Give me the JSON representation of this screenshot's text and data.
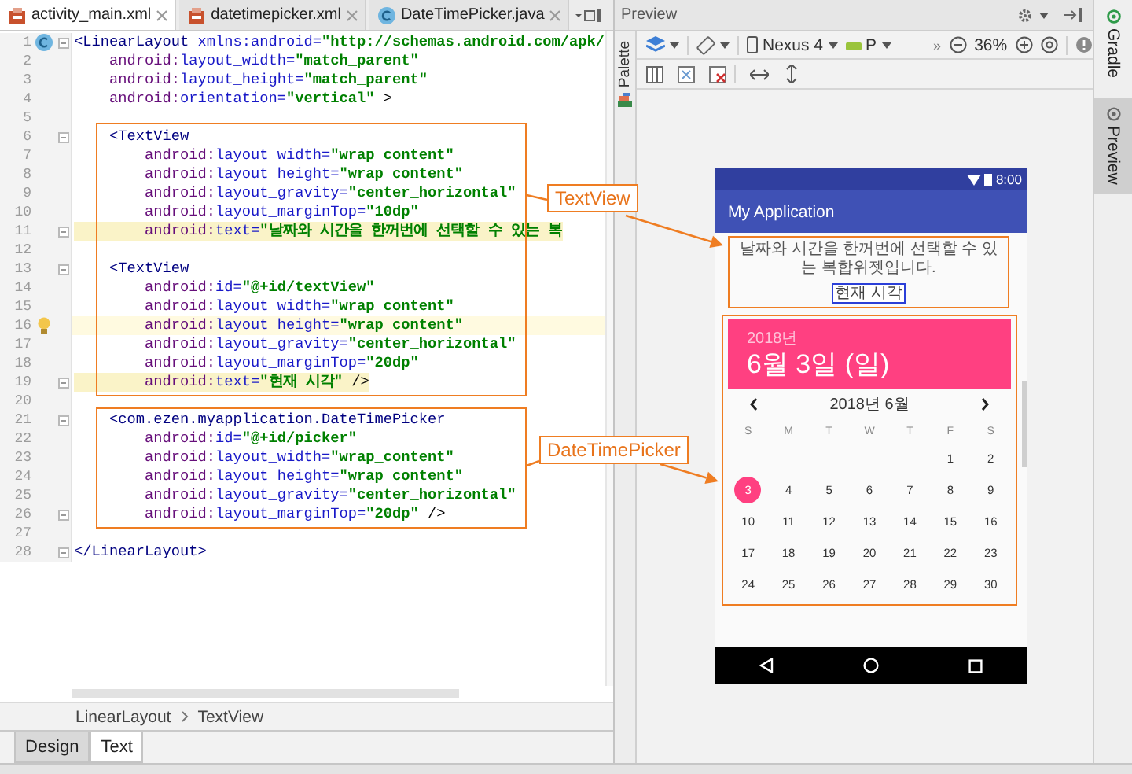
{
  "editor_tabs": [
    {
      "label": "activity_main.xml",
      "selected": true
    },
    {
      "label": "datetimepicker.xml",
      "selected": false
    },
    {
      "label": "DateTimePicker.java",
      "selected": false
    }
  ],
  "code_lines": [
    {
      "number": "1",
      "fold": true,
      "current": false,
      "highlighted": false,
      "segments": [
        {
          "kind": "tag",
          "text": "<LinearLayout"
        },
        {
          "kind": "attr",
          "text": " xmlns:android="
        },
        {
          "kind": "value",
          "text": "\"http://schemas.android.com/apk/"
        }
      ]
    },
    {
      "number": "2",
      "fold": false,
      "current": false,
      "highlighted": false,
      "segments": [
        {
          "kind": "ns",
          "text": "    android:"
        },
        {
          "kind": "attr",
          "text": "layout_width="
        },
        {
          "kind": "value",
          "text": "\"match_parent\""
        }
      ]
    },
    {
      "number": "3",
      "fold": false,
      "current": false,
      "highlighted": false,
      "segments": [
        {
          "kind": "ns",
          "text": "    android:"
        },
        {
          "kind": "attr",
          "text": "layout_height="
        },
        {
          "kind": "value",
          "text": "\"match_parent\""
        }
      ]
    },
    {
      "number": "4",
      "fold": false,
      "current": false,
      "highlighted": false,
      "segments": [
        {
          "kind": "ns",
          "text": "    android:"
        },
        {
          "kind": "attr",
          "text": "orientation="
        },
        {
          "kind": "value",
          "text": "\"vertical\""
        },
        {
          "kind": "plain",
          "text": " >"
        }
      ]
    },
    {
      "number": "5",
      "fold": false,
      "current": false,
      "highlighted": false
    },
    {
      "number": "6",
      "fold": true,
      "current": false,
      "highlighted": false,
      "segments": [
        {
          "kind": "tag",
          "text": "    <TextView"
        }
      ]
    },
    {
      "number": "7",
      "fold": false,
      "current": false,
      "highlighted": false,
      "segments": [
        {
          "kind": "ns",
          "text": "        android:"
        },
        {
          "kind": "attr",
          "text": "layout_width="
        },
        {
          "kind": "value",
          "text": "\"wrap_content\""
        }
      ]
    },
    {
      "number": "8",
      "fold": false,
      "current": false,
      "highlighted": false,
      "segments": [
        {
          "kind": "ns",
          "text": "        android:"
        },
        {
          "kind": "attr",
          "text": "layout_height="
        },
        {
          "kind": "value",
          "text": "\"wrap_content\""
        }
      ]
    },
    {
      "number": "9",
      "fold": false,
      "current": false,
      "highlighted": false,
      "segments": [
        {
          "kind": "ns",
          "text": "        android:"
        },
        {
          "kind": "attr",
          "text": "layout_gravity="
        },
        {
          "kind": "value",
          "text": "\"center_horizontal\""
        }
      ]
    },
    {
      "number": "10",
      "fold": false,
      "current": false,
      "highlighted": false,
      "segments": [
        {
          "kind": "ns",
          "text": "        android:"
        },
        {
          "kind": "attr",
          "text": "layout_marginTop="
        },
        {
          "kind": "value",
          "text": "\"10dp\""
        }
      ]
    },
    {
      "number": "11",
      "fold": true,
      "current": false,
      "highlighted": true,
      "segments": [
        {
          "kind": "ns",
          "text": "        android:"
        },
        {
          "kind": "attr",
          "text": "text="
        },
        {
          "kind": "value",
          "text": "\"날짜와 시간을 한꺼번에 선택할 수 있는 복"
        }
      ]
    },
    {
      "number": "12",
      "fold": false,
      "current": false,
      "highlighted": false
    },
    {
      "number": "13",
      "fold": true,
      "current": false,
      "highlighted": false,
      "segments": [
        {
          "kind": "tag",
          "text": "    <TextView"
        }
      ]
    },
    {
      "number": "14",
      "fold": false,
      "current": false,
      "highlighted": false,
      "segments": [
        {
          "kind": "ns",
          "text": "        android:"
        },
        {
          "kind": "attr",
          "text": "id="
        },
        {
          "kind": "value",
          "text": "\"@+id/textView\""
        }
      ]
    },
    {
      "number": "15",
      "fold": false,
      "current": false,
      "highlighted": false,
      "segments": [
        {
          "kind": "ns",
          "text": "        android:"
        },
        {
          "kind": "attr",
          "text": "layout_width="
        },
        {
          "kind": "value",
          "text": "\"wrap_content\""
        }
      ]
    },
    {
      "number": "16",
      "fold": false,
      "current": true,
      "highlighted": false,
      "segments": [
        {
          "kind": "ns",
          "text": "        android:"
        },
        {
          "kind": "attr",
          "text": "layout_height="
        },
        {
          "kind": "value",
          "text": "\"wrap_content\""
        }
      ]
    },
    {
      "number": "17",
      "fold": false,
      "current": false,
      "highlighted": false,
      "segments": [
        {
          "kind": "ns",
          "text": "        android:"
        },
        {
          "kind": "attr",
          "text": "layout_gravity="
        },
        {
          "kind": "value",
          "text": "\"center_horizontal\""
        }
      ]
    },
    {
      "number": "18",
      "fold": false,
      "current": false,
      "highlighted": false,
      "segments": [
        {
          "kind": "ns",
          "text": "        android:"
        },
        {
          "kind": "attr",
          "text": "layout_marginTop="
        },
        {
          "kind": "value",
          "text": "\"20dp\""
        }
      ]
    },
    {
      "number": "19",
      "fold": true,
      "current": false,
      "highlighted": true,
      "segments": [
        {
          "kind": "ns",
          "text": "        android:"
        },
        {
          "kind": "attr",
          "text": "text="
        },
        {
          "kind": "value",
          "text": "\"현재 시각\""
        },
        {
          "kind": "plain",
          "text": " />"
        }
      ]
    },
    {
      "number": "20",
      "fold": false,
      "current": false,
      "highlighted": false
    },
    {
      "number": "21",
      "fold": true,
      "current": false,
      "highlighted": false,
      "segments": [
        {
          "kind": "tag",
          "text": "    <com.ezen.myapplication.DateTimePicker"
        }
      ]
    },
    {
      "number": "22",
      "fold": false,
      "current": false,
      "highlighted": false,
      "segments": [
        {
          "kind": "ns",
          "text": "        android:"
        },
        {
          "kind": "attr",
          "text": "id="
        },
        {
          "kind": "value",
          "text": "\"@+id/picker\""
        }
      ]
    },
    {
      "number": "23",
      "fold": false,
      "current": false,
      "highlighted": false,
      "segments": [
        {
          "kind": "ns",
          "text": "        android:"
        },
        {
          "kind": "attr",
          "text": "layout_width="
        },
        {
          "kind": "value",
          "text": "\"wrap_content\""
        }
      ]
    },
    {
      "number": "24",
      "fold": false,
      "current": false,
      "highlighted": false,
      "segments": [
        {
          "kind": "ns",
          "text": "        android:"
        },
        {
          "kind": "attr",
          "text": "layout_height="
        },
        {
          "kind": "value",
          "text": "\"wrap_content\""
        }
      ]
    },
    {
      "number": "25",
      "fold": false,
      "current": false,
      "highlighted": false,
      "segments": [
        {
          "kind": "ns",
          "text": "        android:"
        },
        {
          "kind": "attr",
          "text": "layout_gravity="
        },
        {
          "kind": "value",
          "text": "\"center_horizontal\""
        }
      ]
    },
    {
      "number": "26",
      "fold": true,
      "current": false,
      "highlighted": false,
      "segments": [
        {
          "kind": "ns",
          "text": "        android:"
        },
        {
          "kind": "attr",
          "text": "layout_marginTop="
        },
        {
          "kind": "value",
          "text": "\"20dp\""
        },
        {
          "kind": "plain",
          "text": " />"
        }
      ]
    },
    {
      "number": "27",
      "fold": false,
      "current": false,
      "highlighted": false
    },
    {
      "number": "28",
      "fold": true,
      "current": false,
      "highlighted": false,
      "segments": [
        {
          "kind": "tag",
          "text": "</LinearLayout>"
        }
      ]
    }
  ],
  "breadcrumb": [
    "LinearLayout",
    "TextView"
  ],
  "bottom_tabs": [
    {
      "label": "Design",
      "selected": false
    },
    {
      "label": "Text",
      "selected": true
    }
  ],
  "preview": {
    "title": "Preview",
    "palette_label": "Palette",
    "device": "Nexus 4",
    "api": "P",
    "overflow": "»",
    "zoom": "36%"
  },
  "side_tabs": [
    {
      "label": "Gradle",
      "selected": false
    },
    {
      "label": "Preview",
      "selected": true
    }
  ],
  "phone": {
    "time": "8:00",
    "app_title": "My Application",
    "intro_text": "날짜와 시간을 한꺼번에 선택할 수 있는 복합위젯입니다.",
    "time_button": "현재 시각",
    "calendar": {
      "year": "2018년",
      "date": "6월 3일 (일)",
      "month_label": "2018년 6월",
      "weekdays": [
        "S",
        "M",
        "T",
        "W",
        "T",
        "F",
        "S"
      ],
      "days": [
        {
          "kind": "blank"
        },
        {
          "kind": "blank"
        },
        {
          "kind": "blank"
        },
        {
          "kind": "blank"
        },
        {
          "kind": "blank"
        },
        {
          "kind": "day",
          "label": "1",
          "selected": false
        },
        {
          "kind": "day",
          "label": "2",
          "selected": false
        },
        {
          "kind": "day",
          "label": "3",
          "selected": true
        },
        {
          "kind": "day",
          "label": "4",
          "selected": false
        },
        {
          "kind": "day",
          "label": "5",
          "selected": false
        },
        {
          "kind": "day",
          "label": "6",
          "selected": false
        },
        {
          "kind": "day",
          "label": "7",
          "selected": false
        },
        {
          "kind": "day",
          "label": "8",
          "selected": false
        },
        {
          "kind": "day",
          "label": "9",
          "selected": false
        },
        {
          "kind": "day",
          "label": "10",
          "selected": false
        },
        {
          "kind": "day",
          "label": "11",
          "selected": false
        },
        {
          "kind": "day",
          "label": "12",
          "selected": false
        },
        {
          "kind": "day",
          "label": "13",
          "selected": false
        },
        {
          "kind": "day",
          "label": "14",
          "selected": false
        },
        {
          "kind": "day",
          "label": "15",
          "selected": false
        },
        {
          "kind": "day",
          "label": "16",
          "selected": false
        },
        {
          "kind": "day",
          "label": "17",
          "selected": false
        },
        {
          "kind": "day",
          "label": "18",
          "selected": false
        },
        {
          "kind": "day",
          "label": "19",
          "selected": false
        },
        {
          "kind": "day",
          "label": "20",
          "selected": false
        },
        {
          "kind": "day",
          "label": "21",
          "selected": false
        },
        {
          "kind": "day",
          "label": "22",
          "selected": false
        },
        {
          "kind": "day",
          "label": "23",
          "selected": false
        },
        {
          "kind": "day",
          "label": "24",
          "selected": false
        },
        {
          "kind": "day",
          "label": "25",
          "selected": false
        },
        {
          "kind": "day",
          "label": "26",
          "selected": false
        },
        {
          "kind": "day",
          "label": "27",
          "selected": false
        },
        {
          "kind": "day",
          "label": "28",
          "selected": false
        },
        {
          "kind": "day",
          "label": "29",
          "selected": false
        },
        {
          "kind": "day",
          "label": "30",
          "selected": false
        }
      ]
    }
  },
  "annotations": [
    {
      "label": "TextView"
    },
    {
      "label": "DateTimePicker"
    }
  ]
}
